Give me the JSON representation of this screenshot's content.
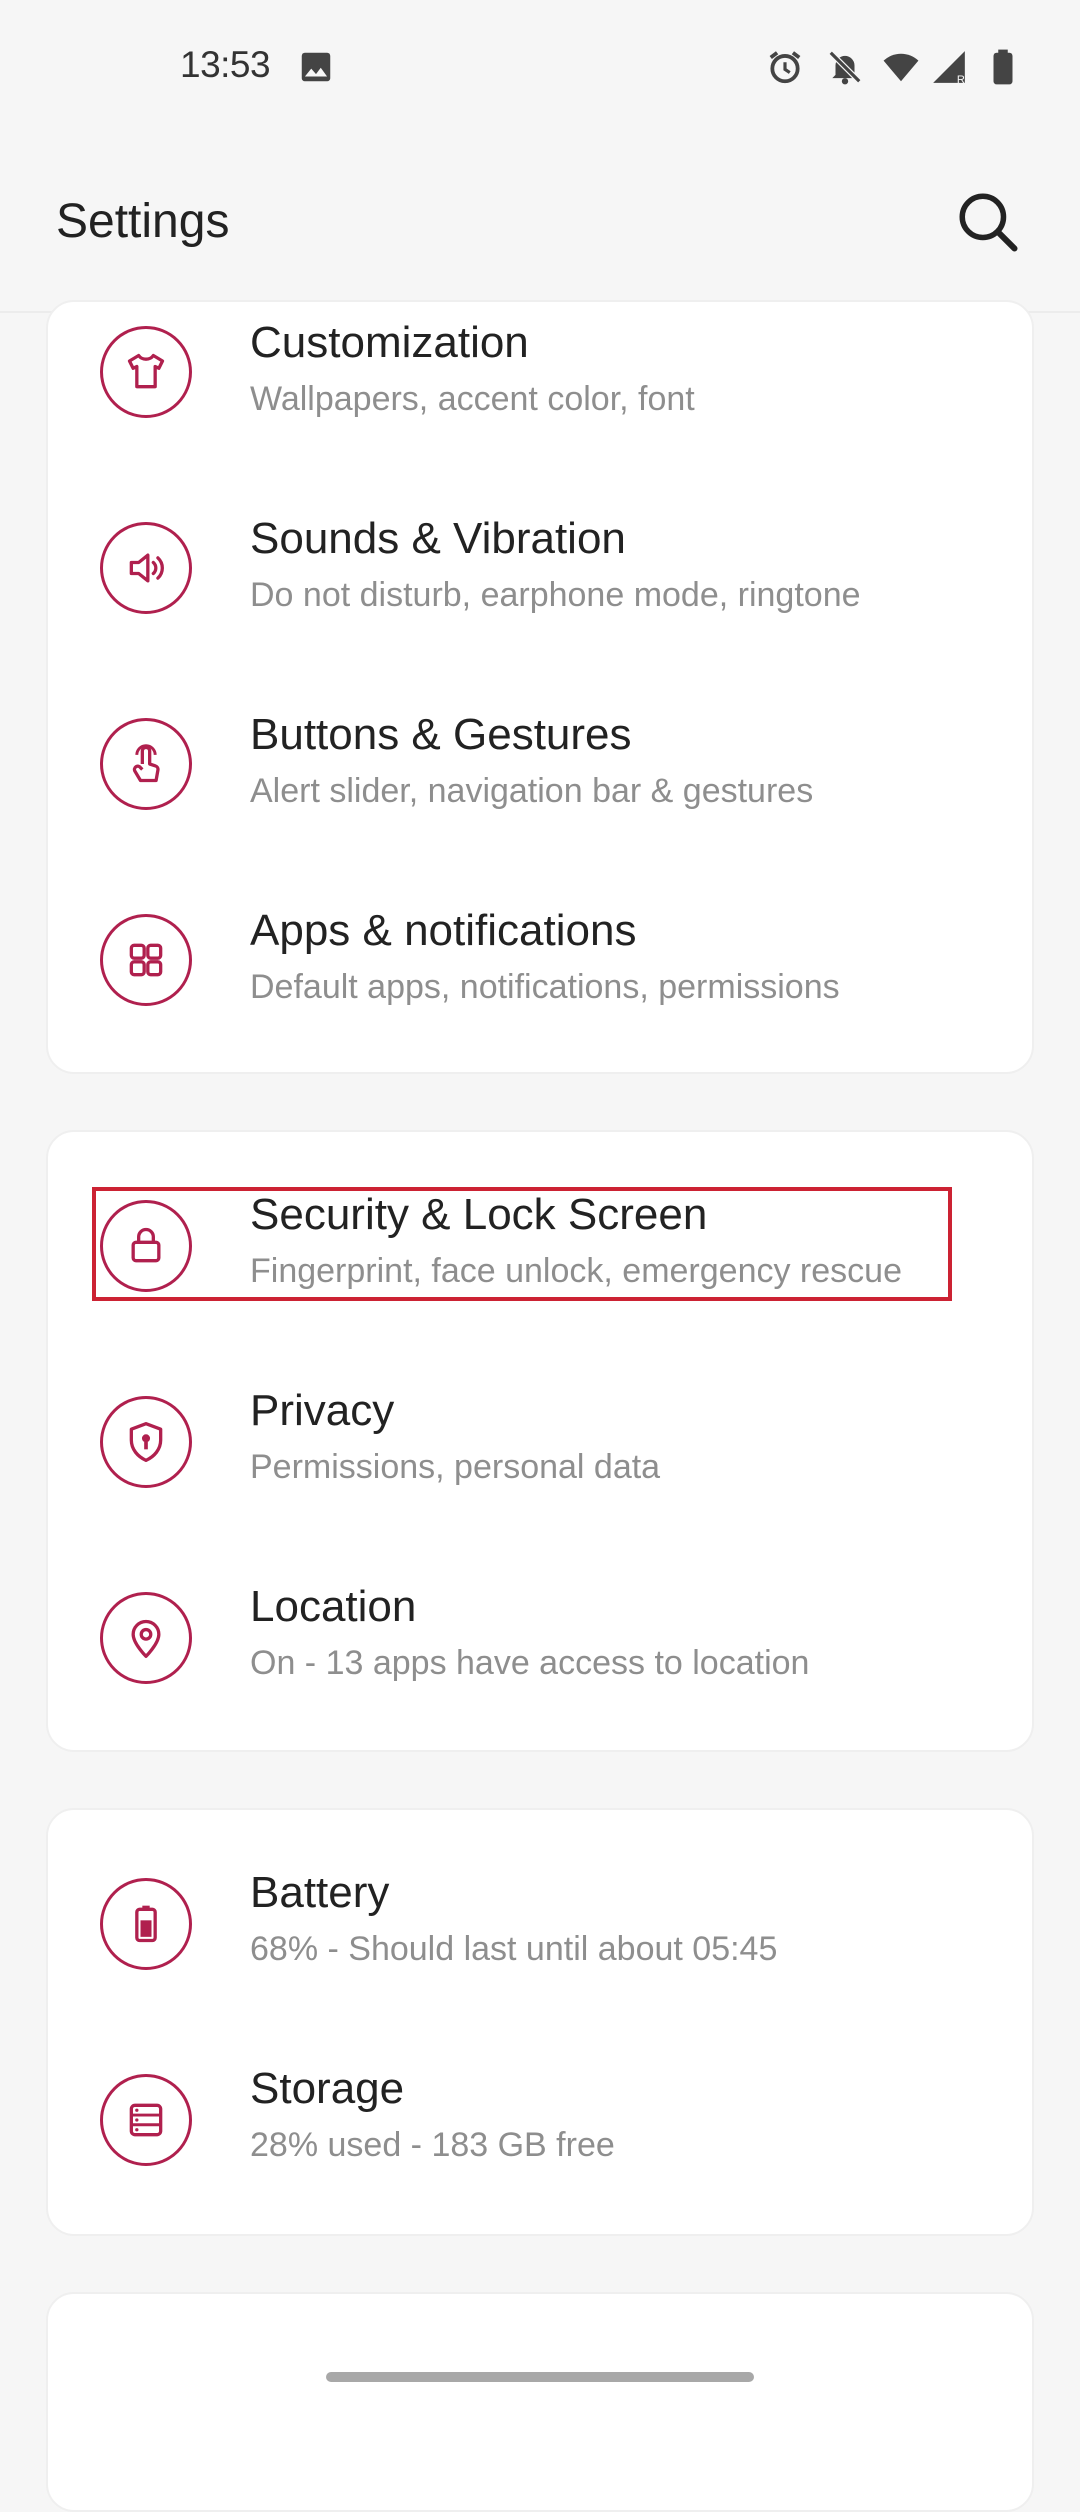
{
  "status_bar": {
    "time": "13:53",
    "icons": [
      "image-icon",
      "alarm-icon",
      "notifications-off-icon",
      "wifi-icon",
      "signal-icon",
      "battery-icon"
    ]
  },
  "app_bar": {
    "title": "Settings",
    "search_icon": "search-icon"
  },
  "accent_color": "#b0204e",
  "highlight_color": "#cc2233",
  "sections": [
    {
      "items": [
        {
          "icon": "shirt-icon",
          "title": "Customization",
          "subtitle": "Wallpapers, accent color, font"
        },
        {
          "icon": "speaker-icon",
          "title": "Sounds & Vibration",
          "subtitle": "Do not disturb, earphone mode, ringtone"
        },
        {
          "icon": "gesture-icon",
          "title": "Buttons & Gestures",
          "subtitle": "Alert slider, navigation bar & gestures"
        },
        {
          "icon": "apps-grid-icon",
          "title": "Apps & notifications",
          "subtitle": "Default apps, notifications, permissions"
        }
      ]
    },
    {
      "items": [
        {
          "icon": "lock-icon",
          "title": "Security & Lock Screen",
          "subtitle": "Fingerprint, face unlock, emergency rescue"
        },
        {
          "icon": "privacy-shield-icon",
          "title": "Privacy",
          "subtitle": "Permissions, personal data"
        },
        {
          "icon": "location-pin-icon",
          "title": "Location",
          "subtitle": "On - 13 apps have access to location"
        }
      ]
    },
    {
      "items": [
        {
          "icon": "battery-icon",
          "title": "Battery",
          "subtitle": "68% - Should last until about 05:45"
        },
        {
          "icon": "storage-icon",
          "title": "Storage",
          "subtitle": "28% used - 183 GB free"
        }
      ]
    }
  ]
}
